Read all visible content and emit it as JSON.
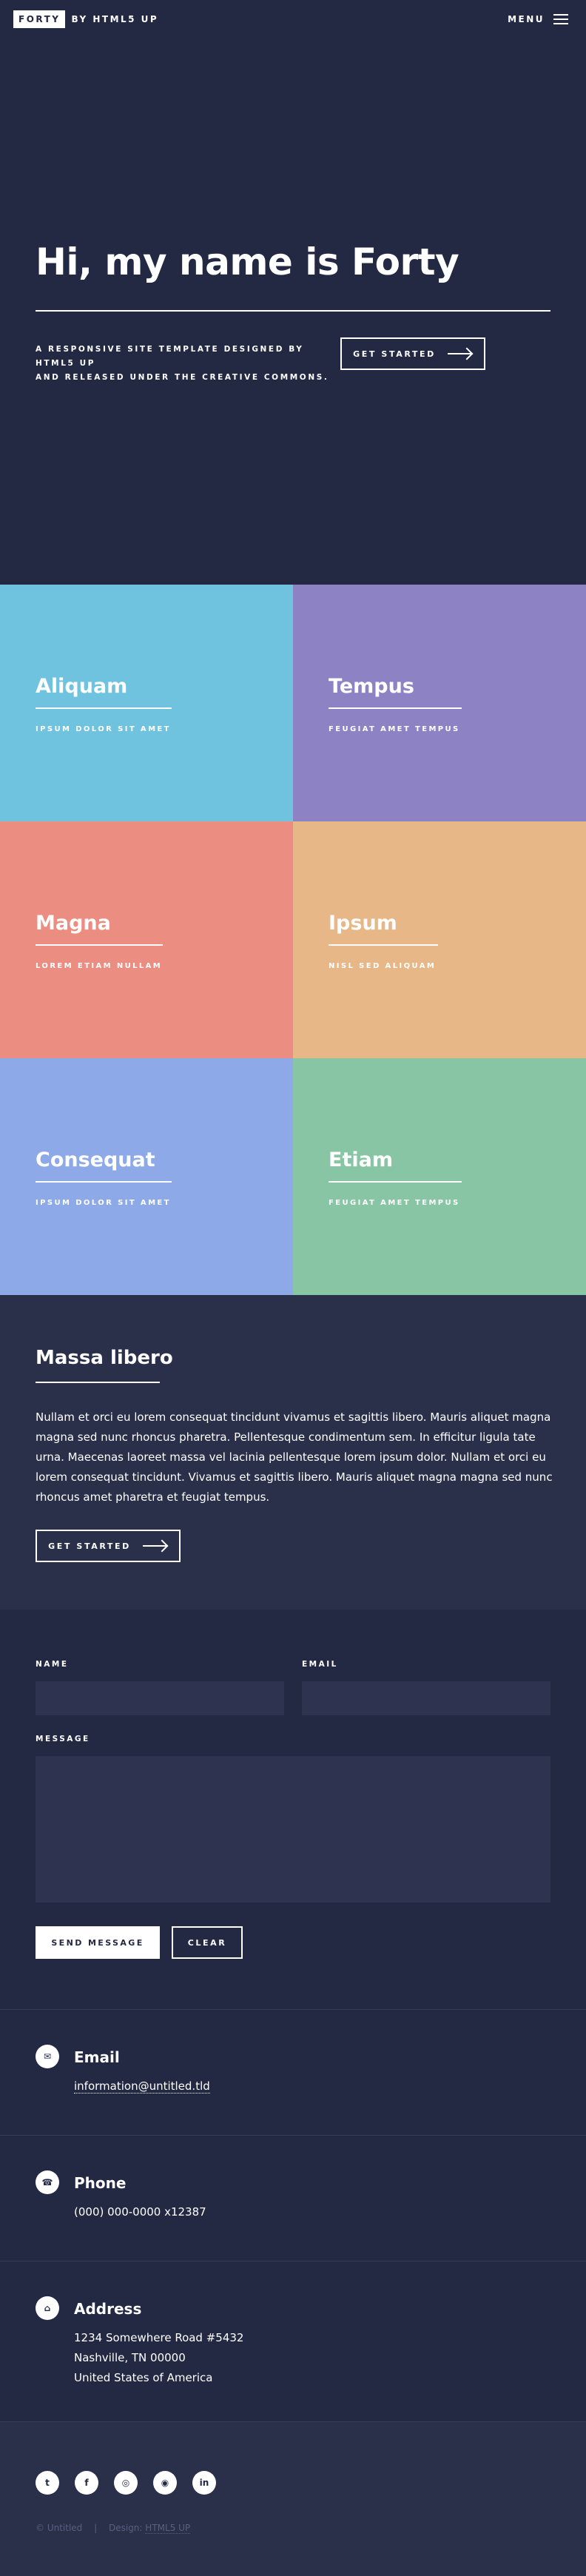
{
  "header": {
    "logo_box": "FORTY",
    "logo_suffix": "BY HTML5 UP",
    "menu_label": "MENU"
  },
  "banner": {
    "title": "Hi, my name is Forty",
    "tagline_line1": "A RESPONSIVE SITE TEMPLATE DESIGNED BY HTML5 UP",
    "tagline_line2": "AND RELEASED UNDER THE CREATIVE COMMONS.",
    "button_label": "GET STARTED"
  },
  "tiles": [
    {
      "title": "Aliquam",
      "subtitle": "IPSUM DOLOR SIT AMET",
      "color": "#6fc3df"
    },
    {
      "title": "Tempus",
      "subtitle": "FEUGIAT AMET TEMPUS",
      "color": "#8d82c4"
    },
    {
      "title": "Magna",
      "subtitle": "LOREM ETIAM NULLAM",
      "color": "#ec8d81"
    },
    {
      "title": "Ipsum",
      "subtitle": "NISL SED ALIQUAM",
      "color": "#e7b788"
    },
    {
      "title": "Consequat",
      "subtitle": "IPSUM DOLOR SIT AMET",
      "color": "#8ea9e8"
    },
    {
      "title": "Etiam",
      "subtitle": "FEUGIAT AMET TEMPUS",
      "color": "#87c5a4"
    }
  ],
  "massa": {
    "title": "Massa libero",
    "body": "Nullam et orci eu lorem consequat tincidunt vivamus et sagittis libero. Mauris aliquet magna magna sed nunc rhoncus pharetra. Pellentesque condimentum sem. In efficitur ligula tate urna. Maecenas laoreet massa vel lacinia pellentesque lorem ipsum dolor. Nullam et orci eu lorem consequat tincidunt. Vivamus et sagittis libero. Mauris aliquet magna magna sed nunc rhoncus amet pharetra et feugiat tempus.",
    "button_label": "GET STARTED"
  },
  "form": {
    "name_label": "NAME",
    "email_label": "EMAIL",
    "message_label": "MESSAGE",
    "send_label": "SEND MESSAGE",
    "clear_label": "CLEAR"
  },
  "contact": {
    "email_title": "Email",
    "email_value": "information@untitled.tld",
    "phone_title": "Phone",
    "phone_value": "(000) 000-0000 x12387",
    "address_title": "Address",
    "address_line1": "1234 Somewhere Road #5432",
    "address_line2": "Nashville, TN 00000",
    "address_line3": "United States of America"
  },
  "footer": {
    "social_icons": [
      "twitter-icon",
      "facebook-icon",
      "instagram-icon",
      "github-icon",
      "linkedin-icon"
    ],
    "copyright": "© Untitled",
    "separator": "|",
    "design_prefix": "Design:",
    "design_link": "HTML5 UP"
  },
  "colors": {
    "background": "#242943",
    "section_alt": "#2a2f4a",
    "field": "#2e3450"
  }
}
